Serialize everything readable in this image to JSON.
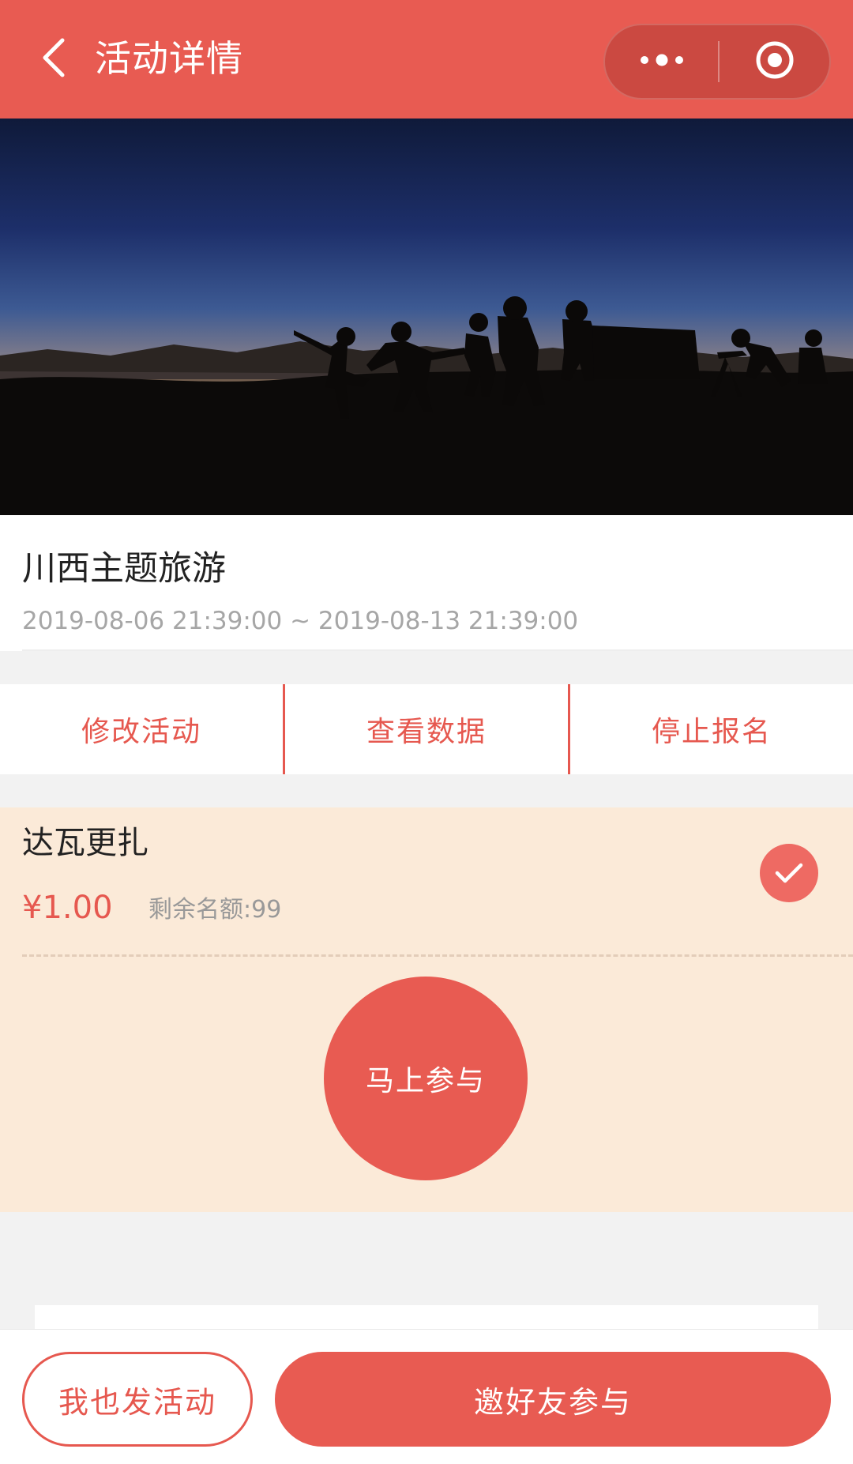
{
  "header": {
    "title": "活动详情",
    "back_icon": "chevron-left-icon",
    "more_icon": "more-dots-icon",
    "close_icon": "target-circle-icon"
  },
  "banner": {
    "image_description": "silhouettes of people on a mountain at sunrise"
  },
  "activity": {
    "title": "川西主题旅游",
    "time_range": "2019-08-06 21:39:00 ~ 2019-08-13 21:39:00"
  },
  "actions": [
    {
      "label": "修改活动"
    },
    {
      "label": "查看数据"
    },
    {
      "label": "停止报名"
    }
  ],
  "ticket": {
    "name": "达瓦更扎",
    "price": "¥1.00",
    "quota": "剩余名额:99",
    "selected": true,
    "join_label": "马上参与"
  },
  "bottom": {
    "post_label": "我也发活动",
    "invite_label": "邀好友参与"
  },
  "colors": {
    "brand": "#e85b52",
    "ticket_bg": "#fbead8",
    "muted": "#a6a6a6"
  }
}
